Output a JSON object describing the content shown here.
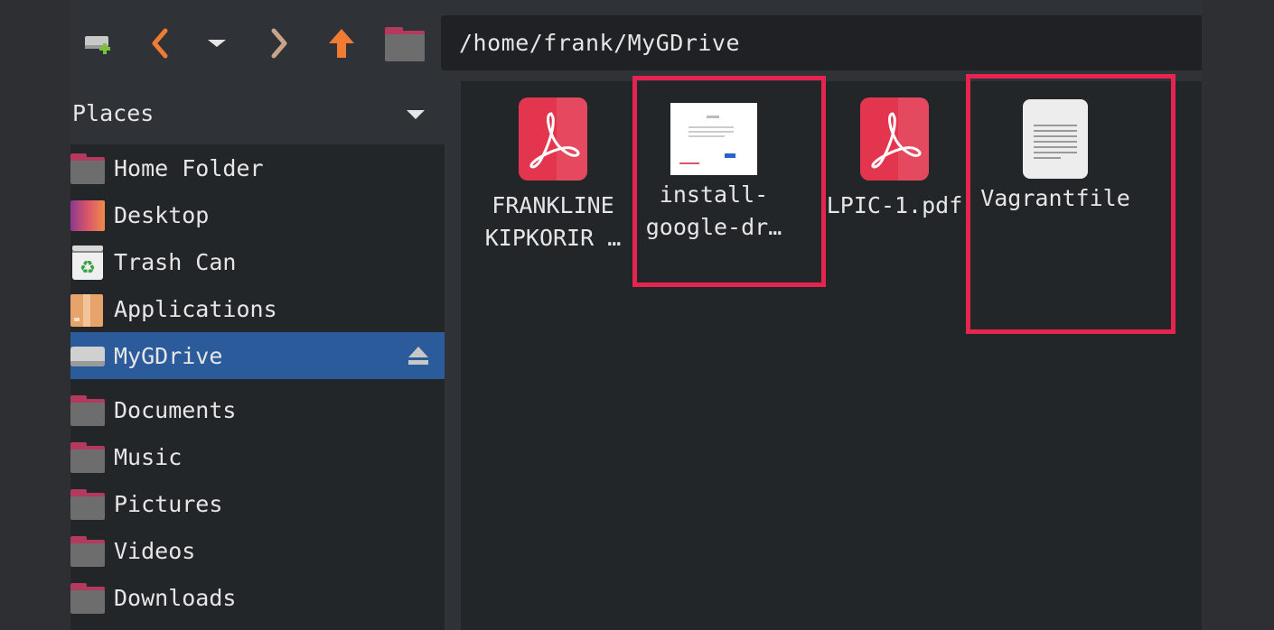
{
  "toolbar": {
    "path": "/home/frank/MyGDrive",
    "buttons": [
      "new-connection",
      "back",
      "history",
      "forward",
      "up",
      "folder"
    ]
  },
  "sidebar": {
    "header": "Places",
    "items": [
      {
        "label": "Home Folder",
        "icon": "folder-icon"
      },
      {
        "label": "Desktop",
        "icon": "desktop-icon"
      },
      {
        "label": "Trash Can",
        "icon": "trash-icon"
      },
      {
        "label": "Applications",
        "icon": "applications-icon"
      },
      {
        "label": "MyGDrive",
        "icon": "drive-icon",
        "active": true
      },
      {
        "label": "Documents",
        "icon": "folder-icon"
      },
      {
        "label": "Music",
        "icon": "folder-icon"
      },
      {
        "label": "Pictures",
        "icon": "folder-icon"
      },
      {
        "label": "Videos",
        "icon": "folder-icon"
      },
      {
        "label": "Downloads",
        "icon": "folder-icon"
      }
    ]
  },
  "files": [
    {
      "line1": "FRANKLINE",
      "line2": "KIPKORIR …",
      "icon": "pdf-icon"
    },
    {
      "line1": "install-",
      "line2": "google-dr…",
      "icon": "image-thumbnail",
      "highlighted": true
    },
    {
      "line1": "LPIC-1.pdf",
      "line2": "",
      "icon": "pdf-icon"
    },
    {
      "line1": "Vagrantfile",
      "line2": "",
      "icon": "text-file-icon",
      "highlighted": true
    }
  ],
  "colors": {
    "accent": "#2b5b9b",
    "highlight": "#e5254f",
    "pdf": "#e3354d"
  }
}
